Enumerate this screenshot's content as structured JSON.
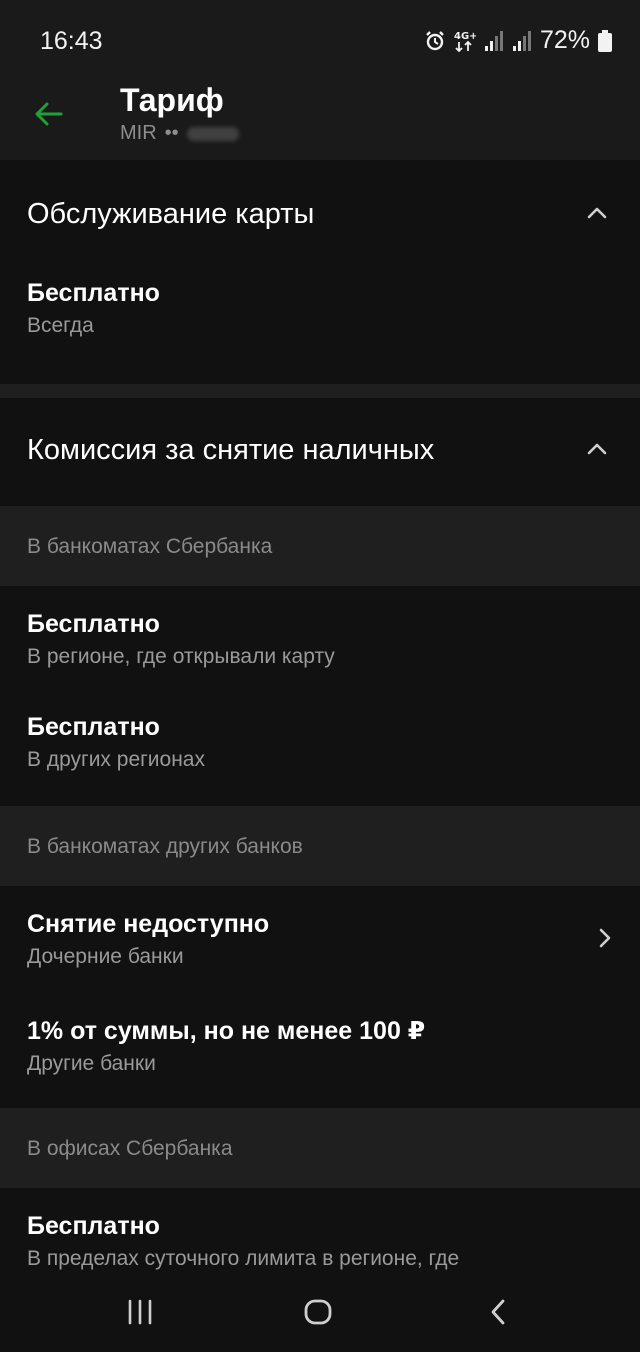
{
  "status_bar": {
    "time": "16:43",
    "network": "4G+",
    "battery": "72%",
    "icons": [
      "alarm-icon",
      "network-4g-icon",
      "signal-icon",
      "signal-icon",
      "battery-icon"
    ]
  },
  "header": {
    "title": "Тариф",
    "card_system": "MIR",
    "card_dots": "••",
    "back_icon": "arrow-left-icon",
    "accent_color": "#21a038"
  },
  "sections": [
    {
      "title": "Обслуживание карты",
      "expanded": true,
      "rows": [
        {
          "primary": "Бесплатно",
          "secondary": "Всегда"
        }
      ]
    },
    {
      "title": "Комиссия за снятие наличных",
      "expanded": true,
      "groups": [
        {
          "label": "В банкоматах Сбербанка",
          "rows": [
            {
              "primary": "Бесплатно",
              "secondary": "В регионе, где открывали карту"
            },
            {
              "primary": "Бесплатно",
              "secondary": "В других регионах"
            }
          ]
        },
        {
          "label": "В банкоматах других банков",
          "rows": [
            {
              "primary": "Снятие недоступно",
              "secondary": "Дочерние банки",
              "has_chevron": true
            },
            {
              "primary": "1% от суммы, но не менее 100 ₽",
              "secondary": "Другие банки"
            }
          ]
        },
        {
          "label": "В офисах Сбербанка",
          "rows": [
            {
              "primary": "Бесплатно",
              "secondary": "В пределах суточного лимита в регионе, где"
            }
          ]
        }
      ]
    }
  ],
  "nav_bar": {
    "icons": [
      "recent-apps-icon",
      "home-icon",
      "back-icon"
    ]
  }
}
